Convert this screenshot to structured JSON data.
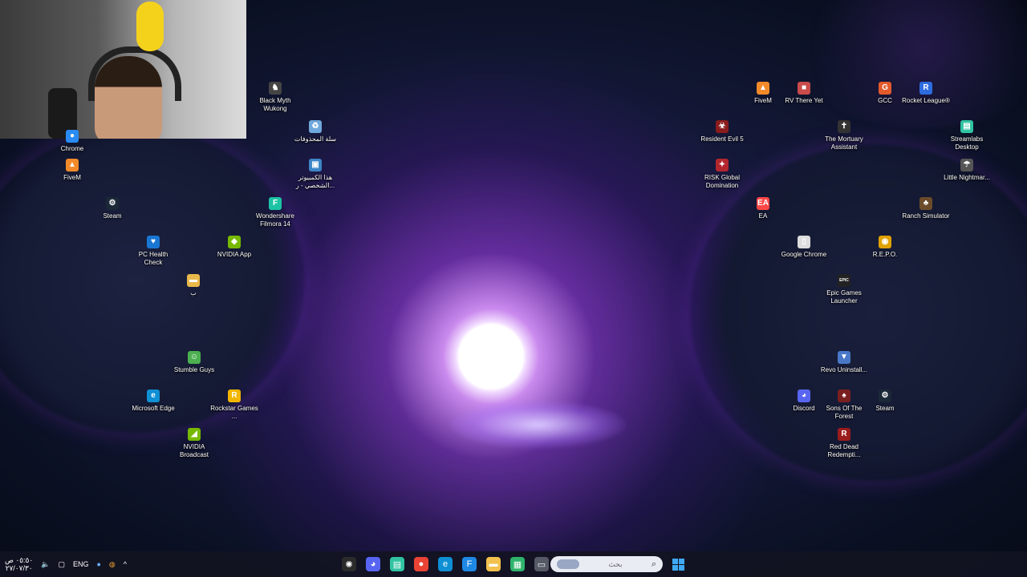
{
  "desktop": {
    "icons": [
      {
        "id": "chrome-left",
        "label": "Chrome",
        "glyph": "●",
        "color": "#2a8bf2"
      },
      {
        "id": "fivem-left",
        "label": "FiveM",
        "glyph": "▲",
        "color": "#f28a2a"
      },
      {
        "id": "steam-left",
        "label": "Steam",
        "glyph": "⚙",
        "color": "#1b2838"
      },
      {
        "id": "pc-health",
        "label": "PC Health Check",
        "glyph": "♥",
        "color": "#1976d2"
      },
      {
        "id": "nvidia-app",
        "label": "NVIDIA App",
        "glyph": "◆",
        "color": "#76b900"
      },
      {
        "id": "folder-b",
        "label": "ب",
        "glyph": "▬",
        "color": "#e8b84a"
      },
      {
        "id": "black-myth",
        "label": "Black Myth Wukong",
        "glyph": "♞",
        "color": "#444444"
      },
      {
        "id": "recycle",
        "label": "سلة المحذوفات",
        "glyph": "♻",
        "color": "#6fa8dc"
      },
      {
        "id": "this-pc",
        "label": "هذا الكمبيوتر الشخصي - ر...",
        "glyph": "▣",
        "color": "#3d85c6"
      },
      {
        "id": "filmora",
        "label": "Wondershare Filmora 14",
        "glyph": "F",
        "color": "#1cc4a4"
      },
      {
        "id": "stumble",
        "label": "Stumble Guys",
        "glyph": "☺",
        "color": "#4caf50"
      },
      {
        "id": "edge",
        "label": "Microsoft Edge",
        "glyph": "e",
        "color": "#0f8fd4"
      },
      {
        "id": "rockstar",
        "label": "Rockstar Games ...",
        "glyph": "R",
        "color": "#f2b600"
      },
      {
        "id": "nvidia-broadcast",
        "label": "NVIDIA Broadcast",
        "glyph": "◢",
        "color": "#76b900"
      },
      {
        "id": "fivem-right",
        "label": "FiveM",
        "glyph": "▲",
        "color": "#f28a2a"
      },
      {
        "id": "rv-there-yet",
        "label": "RV There Yet",
        "glyph": "■",
        "color": "#c94b4b"
      },
      {
        "id": "gcc",
        "label": "GCC",
        "glyph": "G",
        "color": "#e35a2b"
      },
      {
        "id": "rocket-league",
        "label": "Rocket League®",
        "glyph": "R",
        "color": "#2d6cdf"
      },
      {
        "id": "resident-evil",
        "label": "Resident Evil 5",
        "glyph": "☣",
        "color": "#8a1c1c"
      },
      {
        "id": "mortuary",
        "label": "The Mortuary Assistant",
        "glyph": "✝",
        "color": "#333333"
      },
      {
        "id": "streamlabs",
        "label": "Streamlabs Desktop",
        "glyph": "▤",
        "color": "#31c3a2"
      },
      {
        "id": "risk",
        "label": "RISK Global Domination",
        "glyph": "✦",
        "color": "#b3262e"
      },
      {
        "id": "little-nightmares",
        "label": "Little Nightmar...",
        "glyph": "☂",
        "color": "#555555"
      },
      {
        "id": "ea",
        "label": "EA",
        "glyph": "EA",
        "color": "#ff4747"
      },
      {
        "id": "ranch-sim",
        "label": "Ranch Simulator",
        "glyph": "♣",
        "color": "#6b4b2a"
      },
      {
        "id": "google-chrome",
        "label": "Google Chrome",
        "glyph": "▯",
        "color": "#dddddd"
      },
      {
        "id": "repo",
        "label": "R.E.P.O.",
        "glyph": "◉",
        "color": "#e0a100"
      },
      {
        "id": "epic",
        "label": "Epic Games Launcher",
        "glyph": "EPIC",
        "color": "#222222"
      },
      {
        "id": "revo",
        "label": "Revo Uninstall...",
        "glyph": "▼",
        "color": "#4a78c8"
      },
      {
        "id": "discord",
        "label": "Discord",
        "glyph": "◕",
        "color": "#5865f2"
      },
      {
        "id": "sons-forest",
        "label": "Sons Of The Forest",
        "glyph": "♠",
        "color": "#7a1f1f"
      },
      {
        "id": "steam-right",
        "label": "Steam",
        "glyph": "⚙",
        "color": "#1b2838"
      },
      {
        "id": "red-dead",
        "label": "Red Dead Redempti...",
        "glyph": "R",
        "color": "#9b1c1c"
      }
    ]
  },
  "taskbar": {
    "time": "٠٥:٥٠ ص",
    "date": "٢٧/٠٧/٣٠",
    "language": "ENG",
    "search_placeholder": "بحث",
    "pinned": [
      {
        "id": "steelseries",
        "glyph": "✺",
        "color": "#2b2b2b"
      },
      {
        "id": "discord",
        "glyph": "◕",
        "color": "#5865f2"
      },
      {
        "id": "streamlabs",
        "glyph": "▤",
        "color": "#31c3a2"
      },
      {
        "id": "chrome",
        "glyph": "●",
        "color": "#ea4335"
      },
      {
        "id": "edge",
        "glyph": "e",
        "color": "#0f8fd4"
      },
      {
        "id": "filmora",
        "glyph": "F",
        "color": "#1e88e5"
      },
      {
        "id": "explorer",
        "glyph": "▬",
        "color": "#f2c14e"
      },
      {
        "id": "widgets",
        "glyph": "▦",
        "color": "#2fb46c"
      },
      {
        "id": "task-view",
        "glyph": "▭",
        "color": "#555a66"
      }
    ]
  }
}
